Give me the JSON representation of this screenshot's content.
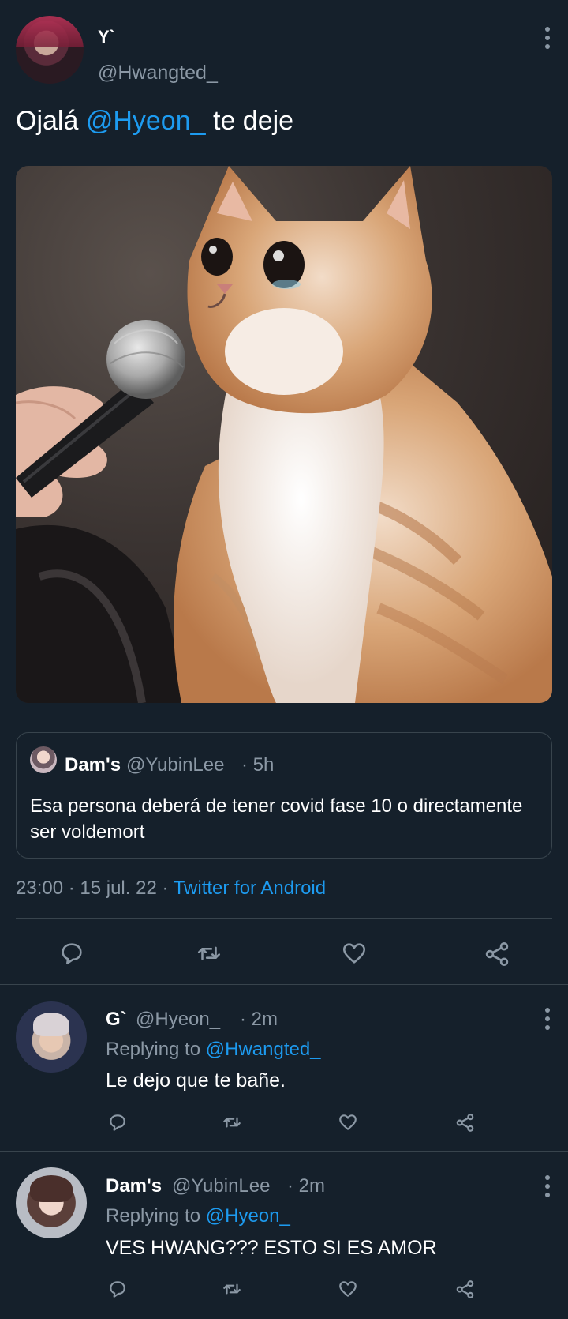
{
  "main_tweet": {
    "display_name": "Y`",
    "handle": "@Hwangted_",
    "text_before": "Ojalá ",
    "mention": "@Hyeon_",
    "text_after": " te deje",
    "quote": {
      "display_name": "Dam's",
      "handle": "@YubinLee",
      "time": "· 5h",
      "text": "Esa persona deberá de tener covid fase 10 o directamente ser voldemort"
    },
    "timestamp": "23:00 · 15 jul. 22 · ",
    "source": "Twitter for Android"
  },
  "replies": [
    {
      "display_name": "G`",
      "handle": "@Hyeon_",
      "time": "· 2m",
      "replying_label": "Replying to ",
      "replying_to": "@Hwangted_",
      "text": "Le dejo que te bañe."
    },
    {
      "display_name": "Dam's",
      "handle": "@YubinLee",
      "time": "· 2m",
      "replying_label": "Replying to ",
      "replying_to": "@Hyeon_",
      "text": "VES HWANG??? ESTO SI ES AMOR"
    }
  ],
  "icons": [
    "reply-icon",
    "retweet-icon",
    "like-icon",
    "share-icon",
    "more-icon"
  ],
  "colors": {
    "background": "#15202b",
    "accent": "#1d9bf0",
    "muted": "#8b98a5",
    "divider": "#38444d"
  }
}
